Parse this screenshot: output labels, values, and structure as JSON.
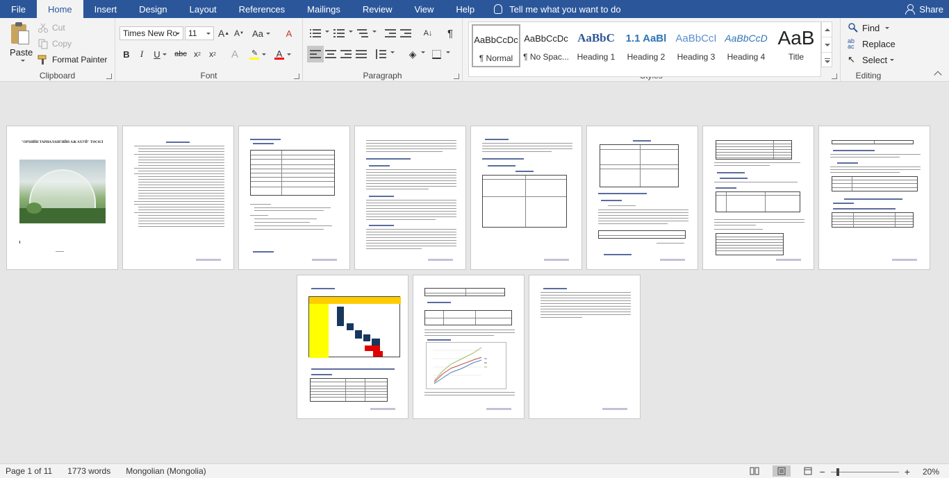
{
  "tabs": [
    {
      "label": "File",
      "active": false
    },
    {
      "label": "Home",
      "active": true
    },
    {
      "label": "Insert",
      "active": false
    },
    {
      "label": "Design",
      "active": false
    },
    {
      "label": "Layout",
      "active": false
    },
    {
      "label": "References",
      "active": false
    },
    {
      "label": "Mailings",
      "active": false
    },
    {
      "label": "Review",
      "active": false
    },
    {
      "label": "View",
      "active": false
    },
    {
      "label": "Help",
      "active": false
    }
  ],
  "tell_me": "Tell me what you want to do",
  "share": "Share",
  "clipboard": {
    "label": "Clipboard",
    "paste": "Paste",
    "cut": "Cut",
    "copy": "Copy",
    "format_painter": "Format Painter"
  },
  "font": {
    "label": "Font",
    "family": "Times New Ro",
    "size": "11"
  },
  "paragraph": {
    "label": "Paragraph"
  },
  "styles": {
    "label": "Styles",
    "items": [
      {
        "preview": "AaBbCcDc",
        "name": "¶ Normal"
      },
      {
        "preview": "AaBbCcDc",
        "name": "¶ No Spac..."
      },
      {
        "preview": "AaBbC",
        "name": "Heading 1"
      },
      {
        "preview": "1.1  AaBl",
        "name": "Heading 2"
      },
      {
        "preview": "AaBbCcI",
        "name": "Heading 3"
      },
      {
        "preview": "AaBbCcD",
        "name": "Heading 4"
      },
      {
        "preview": "AaB",
        "name": "Title"
      }
    ]
  },
  "editing": {
    "label": "Editing",
    "find": "Find",
    "replace": "Replace",
    "select": "Select"
  },
  "document": {
    "cover_title": "\"ОРХИЙН ТАРИАЛАНГИЙН АЖ АХУЙ\" ТӨСӨЛ"
  },
  "status": {
    "page": "Page 1 of 11",
    "words": "1773 words",
    "language": "Mongolian (Mongolia)",
    "zoom": "20%",
    "zoom_fraction": 0.2
  },
  "colors": {
    "brand": "#2b579a",
    "highlight": "#ffff00",
    "font_color": "#ff0000"
  }
}
